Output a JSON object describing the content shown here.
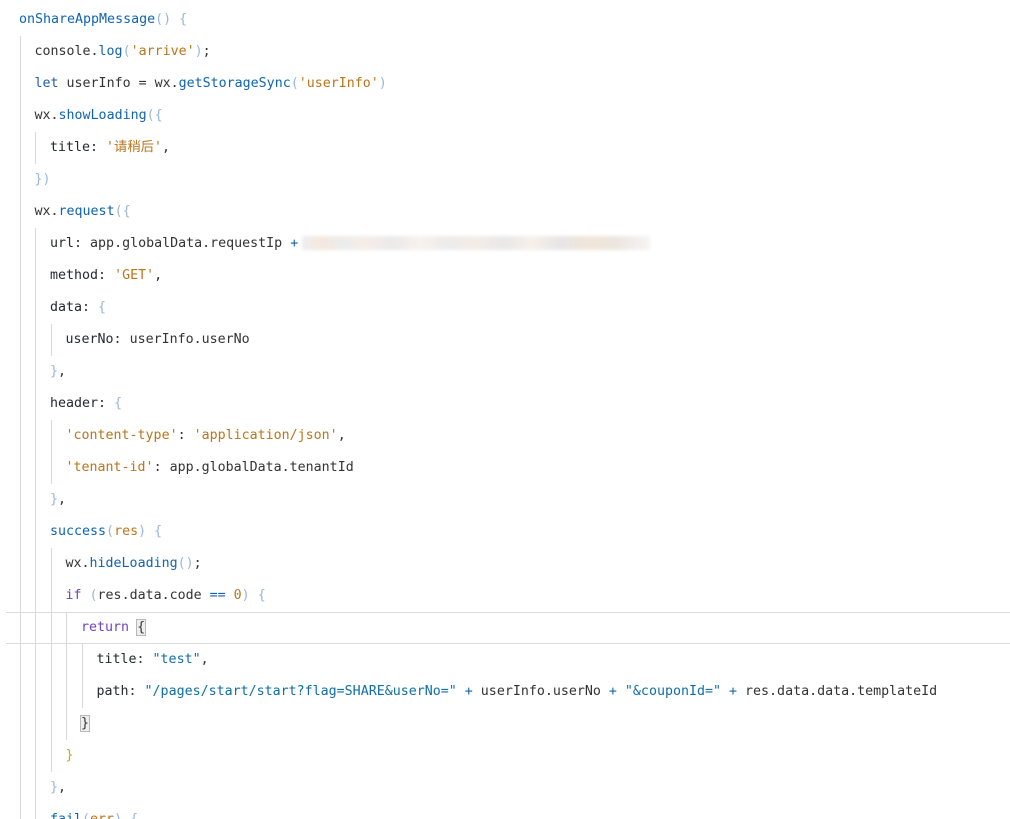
{
  "editor": {
    "lines": [
      {
        "tokens": [
          [
            "fn",
            "onShareAppMessage"
          ],
          [
            "brace",
            "()"
          ],
          [
            "plain",
            " "
          ],
          [
            "brace",
            "{"
          ]
        ]
      },
      {
        "tokens": [
          [
            "plain",
            "console."
          ],
          [
            "fn",
            "log"
          ],
          [
            "brace",
            "("
          ],
          [
            "str",
            "'arrive'"
          ],
          [
            "brace",
            ")"
          ],
          [
            "punct",
            ";"
          ]
        ]
      },
      {
        "tokens": [
          [
            "kw-blue",
            "let"
          ],
          [
            "plain",
            " userInfo = wx."
          ],
          [
            "fn",
            "getStorageSync"
          ],
          [
            "brace",
            "("
          ],
          [
            "str",
            "'userInfo'"
          ],
          [
            "brace",
            ")"
          ]
        ]
      },
      {
        "tokens": [
          [
            "plain",
            "wx."
          ],
          [
            "fn",
            "showLoading"
          ],
          [
            "brace",
            "({"
          ]
        ]
      },
      {
        "tokens": [
          [
            "prop",
            "title"
          ],
          [
            "punct",
            ": "
          ],
          [
            "str",
            "'请稍后'"
          ],
          [
            "punct",
            ","
          ]
        ]
      },
      {
        "tokens": [
          [
            "brace",
            "})"
          ]
        ]
      },
      {
        "tokens": [
          [
            "plain",
            "wx."
          ],
          [
            "fn",
            "request"
          ],
          [
            "brace",
            "({"
          ]
        ]
      },
      {
        "tokens": [
          [
            "prop",
            "url"
          ],
          [
            "punct",
            ": "
          ],
          [
            "plain",
            "app.globalData.requestIp "
          ],
          [
            "op",
            "+"
          ]
        ],
        "redacted": true
      },
      {
        "tokens": [
          [
            "prop",
            "method"
          ],
          [
            "punct",
            ": "
          ],
          [
            "str",
            "'GET'"
          ],
          [
            "punct",
            ","
          ]
        ]
      },
      {
        "tokens": [
          [
            "prop",
            "data"
          ],
          [
            "punct",
            ": "
          ],
          [
            "brace",
            "{"
          ]
        ]
      },
      {
        "tokens": [
          [
            "prop",
            "userNo"
          ],
          [
            "punct",
            ": "
          ],
          [
            "plain",
            "userInfo.userNo"
          ]
        ]
      },
      {
        "tokens": [
          [
            "brace",
            "}"
          ],
          [
            "punct",
            ","
          ]
        ]
      },
      {
        "tokens": [
          [
            "prop",
            "header"
          ],
          [
            "punct",
            ": "
          ],
          [
            "brace",
            "{"
          ]
        ]
      },
      {
        "tokens": [
          [
            "str",
            "'content-type'"
          ],
          [
            "punct",
            ": "
          ],
          [
            "str",
            "'application/json'"
          ],
          [
            "punct",
            ","
          ]
        ]
      },
      {
        "tokens": [
          [
            "str",
            "'tenant-id'"
          ],
          [
            "punct",
            ": "
          ],
          [
            "plain",
            "app.globalData.tenantId"
          ]
        ]
      },
      {
        "tokens": [
          [
            "brace",
            "}"
          ],
          [
            "punct",
            ","
          ]
        ]
      },
      {
        "tokens": [
          [
            "fn",
            "success"
          ],
          [
            "brace",
            "("
          ],
          [
            "str",
            "res"
          ],
          [
            "brace",
            ")"
          ],
          [
            "plain",
            " "
          ],
          [
            "brace",
            "{"
          ]
        ]
      },
      {
        "tokens": [
          [
            "plain",
            "wx."
          ],
          [
            "fn",
            "hideLoading"
          ],
          [
            "brace",
            "()"
          ],
          [
            "punct",
            ";"
          ]
        ]
      },
      {
        "tokens": [
          [
            "kw",
            "if"
          ],
          [
            "plain",
            " "
          ],
          [
            "brace",
            "("
          ],
          [
            "plain",
            "res.data.code "
          ],
          [
            "op",
            "=="
          ],
          [
            "plain",
            " "
          ],
          [
            "num",
            "0"
          ],
          [
            "brace",
            ")"
          ],
          [
            "plain",
            " "
          ],
          [
            "brace",
            "{"
          ]
        ]
      },
      {
        "tokens": [
          [
            "kw",
            "return"
          ],
          [
            "plain",
            " "
          ],
          [
            "bracket-hl",
            "{"
          ]
        ]
      },
      {
        "tokens": [
          [
            "prop",
            "title"
          ],
          [
            "punct",
            ": "
          ],
          [
            "str-dq",
            "\"test\""
          ],
          [
            "punct",
            ","
          ]
        ]
      },
      {
        "tokens": [
          [
            "prop",
            "path"
          ],
          [
            "punct",
            ": "
          ],
          [
            "str-dq",
            "\"/pages/start/start?flag=SHARE&userNo=\""
          ],
          [
            "plain",
            " "
          ],
          [
            "op",
            "+"
          ],
          [
            "plain",
            " userInfo.userNo "
          ],
          [
            "op",
            "+"
          ],
          [
            "plain",
            " "
          ],
          [
            "str-dq",
            "\"&couponId=\""
          ],
          [
            "plain",
            " "
          ],
          [
            "op",
            "+"
          ],
          [
            "plain",
            " res.data.data.templateId"
          ]
        ]
      },
      {
        "tokens": [
          [
            "bracket-hl",
            "}"
          ]
        ]
      },
      {
        "tokens": [
          [
            "brace-y",
            "}"
          ]
        ]
      },
      {
        "tokens": [
          [
            "brace",
            "}"
          ],
          [
            "punct",
            ","
          ]
        ]
      },
      {
        "tokens": [
          [
            "fn",
            "fail"
          ],
          [
            "brace",
            "("
          ],
          [
            "str",
            "err"
          ],
          [
            "brace",
            ")"
          ],
          [
            "plain",
            " "
          ],
          [
            "brace",
            "{"
          ]
        ]
      }
    ]
  }
}
